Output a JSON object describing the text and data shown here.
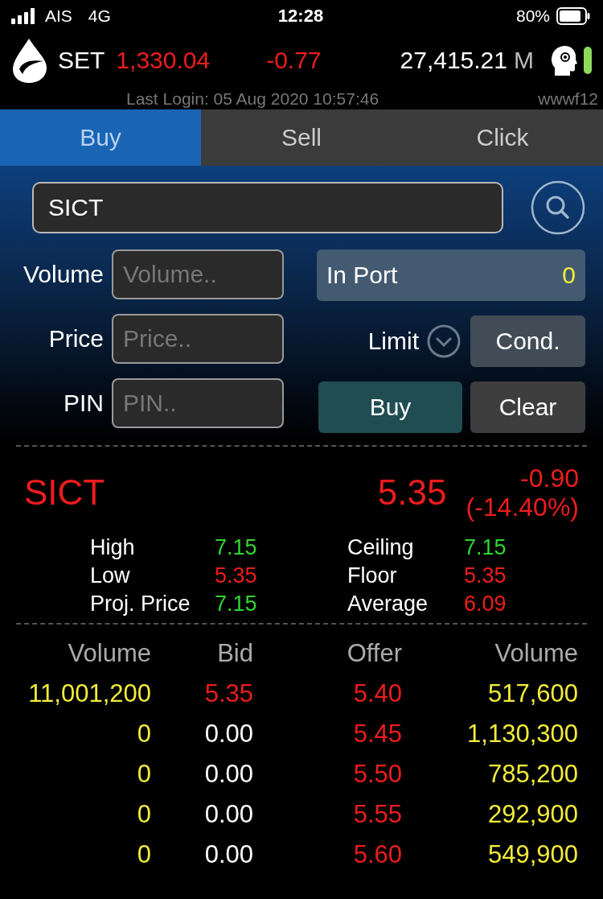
{
  "status_bar": {
    "carrier": "AIS",
    "network": "4G",
    "time": "12:28",
    "battery": "80%"
  },
  "header": {
    "index_name": "SET",
    "index_value": "1,330.04",
    "change": "-0.77",
    "value": "27,415.21",
    "unit": "M",
    "last_login": "Last Login: 05 Aug 2020 10:57:46",
    "user": "wwwf12"
  },
  "tabs": [
    {
      "label": "Buy",
      "selected": true
    },
    {
      "label": "Sell",
      "selected": false
    },
    {
      "label": "Click",
      "selected": false
    }
  ],
  "symbol_field": {
    "value": "SICT"
  },
  "form": {
    "fields": [
      {
        "label": "Volume",
        "placeholder": "Volume.."
      },
      {
        "label": "Price",
        "placeholder": "Price.."
      },
      {
        "label": "PIN",
        "placeholder": "PIN.."
      }
    ],
    "in_port": {
      "label": "In Port",
      "value": "0"
    },
    "order_type": "Limit",
    "cond_button": "Cond.",
    "buy_button": "Buy",
    "clear_button": "Clear"
  },
  "quote": {
    "symbol": "SICT",
    "price": "5.35",
    "change": "-0.90",
    "percent": "(-14.40%)"
  },
  "stats": [
    {
      "label": "High",
      "value": "7.15",
      "color": "#2fd62f"
    },
    {
      "label": "Ceiling",
      "value": "7.15",
      "color": "#2fd62f"
    },
    {
      "label": "Low",
      "value": "5.35",
      "color": "#ee1c1c"
    },
    {
      "label": "Floor",
      "value": "5.35",
      "color": "#ee1c1c"
    },
    {
      "label": "Proj. Price",
      "value": "7.15",
      "color": "#2fd62f"
    },
    {
      "label": "Average",
      "value": "6.09",
      "color": "#ee1c1c"
    }
  ],
  "order_book": {
    "columns": [
      "Volume",
      "Bid",
      "Offer",
      "Volume"
    ],
    "rows": [
      [
        {
          "text": "11,001,200",
          "color": "#f2ec3a"
        },
        {
          "text": "5.35",
          "color": "#ee1c1c"
        },
        {
          "text": "5.40",
          "color": "#ee1c1c"
        },
        {
          "text": "517,600",
          "color": "#f2ec3a"
        }
      ],
      [
        {
          "text": "0",
          "color": "#f2ec3a"
        },
        {
          "text": "0.00",
          "color": "#ffffff"
        },
        {
          "text": "5.45",
          "color": "#ee1c1c"
        },
        {
          "text": "1,130,300",
          "color": "#f2ec3a"
        }
      ],
      [
        {
          "text": "0",
          "color": "#f2ec3a"
        },
        {
          "text": "0.00",
          "color": "#ffffff"
        },
        {
          "text": "5.50",
          "color": "#ee1c1c"
        },
        {
          "text": "785,200",
          "color": "#f2ec3a"
        }
      ],
      [
        {
          "text": "0",
          "color": "#f2ec3a"
        },
        {
          "text": "0.00",
          "color": "#ffffff"
        },
        {
          "text": "5.55",
          "color": "#ee1c1c"
        },
        {
          "text": "292,900",
          "color": "#f2ec3a"
        }
      ],
      [
        {
          "text": "0",
          "color": "#f2ec3a"
        },
        {
          "text": "0.00",
          "color": "#ffffff"
        },
        {
          "text": "5.60",
          "color": "#ee1c1c"
        },
        {
          "text": "549,900",
          "color": "#f2ec3a"
        }
      ]
    ]
  }
}
